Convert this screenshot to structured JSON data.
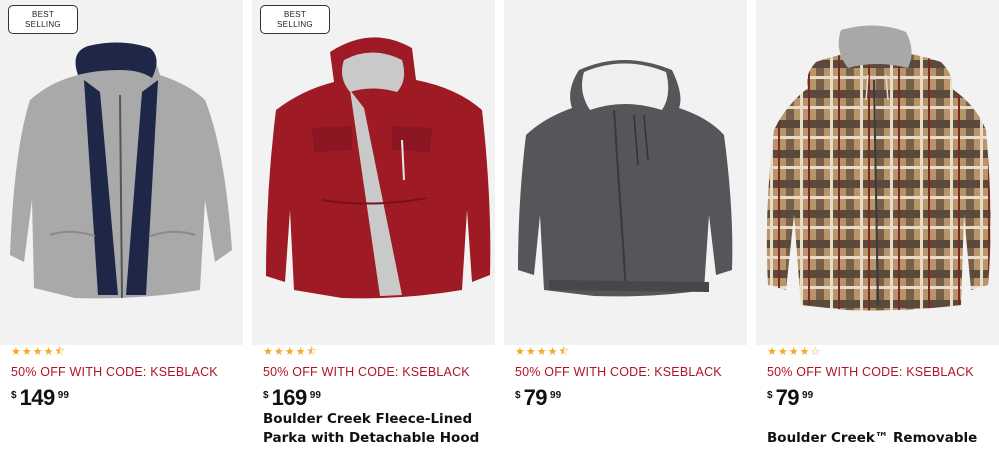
{
  "products": [
    {
      "badge_line1": "BEST",
      "badge_line2": "SELLING",
      "image_icon": "gray-softshell-jacket-icon",
      "stars": "★★★★⯪",
      "promo": "50% OFF WITH CODE: KSEBLACK",
      "currency": "$",
      "price_dollars": "149",
      "price_cents": "99",
      "title": ""
    },
    {
      "badge_line1": "BEST",
      "badge_line2": "SELLING",
      "image_icon": "red-parka-icon",
      "stars": "★★★★⯪",
      "promo": "50% OFF WITH CODE: KSEBLACK",
      "currency": "$",
      "price_dollars": "169",
      "price_cents": "99",
      "title": "Boulder Creek Fleece-Lined Parka with Detachable Hood and"
    },
    {
      "image_icon": "charcoal-sherpa-hoodie-icon",
      "stars": "★★★★⯪",
      "promo": "50% OFF WITH CODE: KSEBLACK",
      "currency": "$",
      "price_dollars": "79",
      "price_cents": "99",
      "title": ""
    },
    {
      "image_icon": "plaid-hooded-shirt-jacket-icon",
      "stars": "★★★★☆",
      "promo": "50% OFF WITH CODE: KSEBLACK",
      "currency": "$",
      "price_dollars": "79",
      "price_cents": "99",
      "title": "Boulder Creek™ Removable Hood"
    }
  ],
  "colors": {
    "promo": "#b0122a",
    "star": "#f5a623",
    "image_bg": "#f2f2f2"
  }
}
